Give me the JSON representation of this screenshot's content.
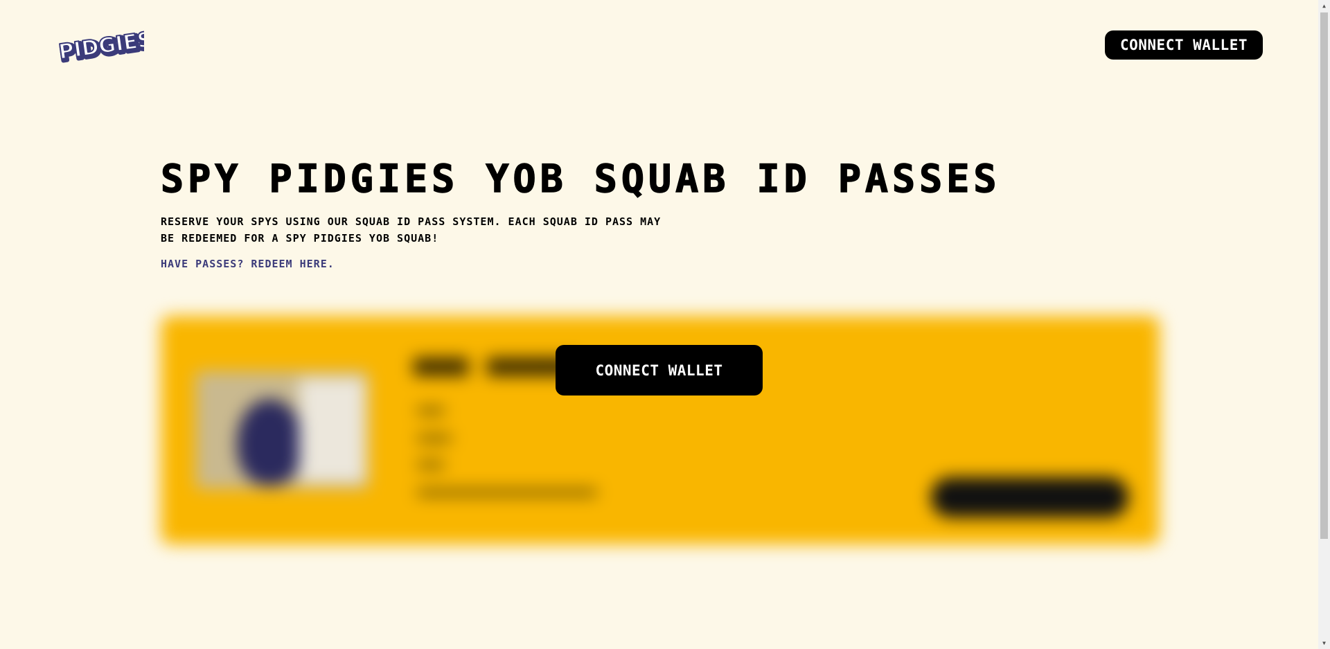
{
  "header": {
    "logo_text": "PIDGIES!",
    "connect_label": "CONNECT WALLET"
  },
  "hero": {
    "title": "SPY PIDGIES YOB SQUAB ID PASSES",
    "description": "RESERVE YOUR SPYS USING OUR SQUAB ID PASS SYSTEM. EACH SQUAB ID PASS MAY BE REDEEMED FOR A SPY PIDGIES YOB SQUAB!",
    "redeem_link": "HAVE PASSES? REDEEM HERE."
  },
  "pass_card": {
    "connect_label": "CONNECT WALLET"
  },
  "colors": {
    "background": "#fdf8e8",
    "card": "#f9b600",
    "link": "#3b3b7a",
    "button": "#000000"
  }
}
